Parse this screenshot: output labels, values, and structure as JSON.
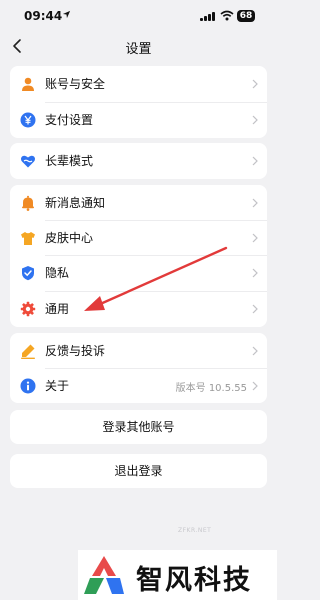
{
  "status_bar": {
    "time": "09:44",
    "battery": "68"
  },
  "header": {
    "title": "设置"
  },
  "groups": [
    {
      "items": [
        {
          "label": "账号与安全",
          "icon": "person-icon"
        },
        {
          "label": "支付设置",
          "icon": "yuan-coin-icon"
        }
      ]
    },
    {
      "items": [
        {
          "label": "长辈模式",
          "icon": "heart-elder-icon"
        }
      ]
    },
    {
      "items": [
        {
          "label": "新消息通知",
          "icon": "bell-icon"
        },
        {
          "label": "皮肤中心",
          "icon": "tshirt-icon"
        },
        {
          "label": "隐私",
          "icon": "shield-check-icon"
        },
        {
          "label": "通用",
          "icon": "gear-icon"
        }
      ]
    },
    {
      "items": [
        {
          "label": "反馈与投诉",
          "icon": "pencil-icon"
        },
        {
          "label": "关于",
          "icon": "info-icon",
          "value": "版本号 10.5.55"
        }
      ]
    }
  ],
  "buttons": {
    "switch_account": "登录其他账号",
    "logout": "退出登录"
  },
  "watermark": "ZFKR.NET",
  "brand": {
    "name": "智风科技"
  },
  "colors": {
    "blue": "#2f73f0",
    "orange": "#f08a24",
    "red": "#ef4b3a",
    "arrow": "#e23a3a"
  }
}
